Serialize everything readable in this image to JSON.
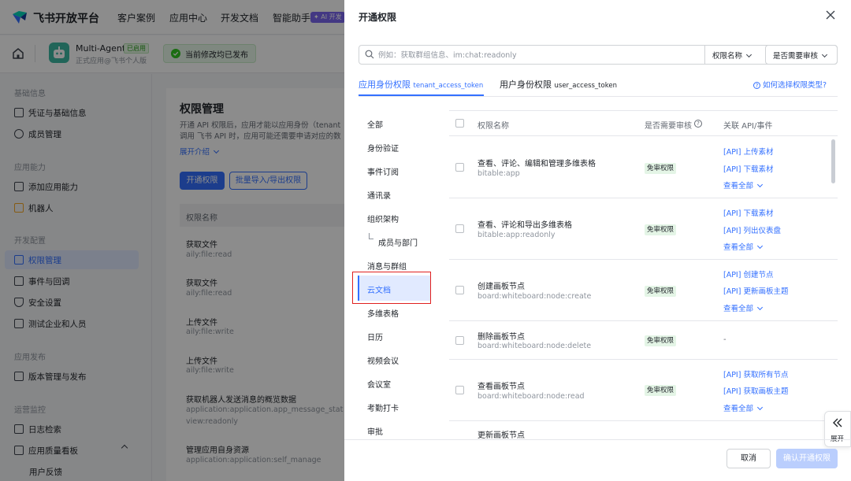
{
  "topnav": {
    "brand": "飞书开放平台",
    "items": [
      "客户案例",
      "应用中心",
      "开发文档",
      "智能助手"
    ],
    "ai_badge": "✦ AI 开发"
  },
  "app_header": {
    "app_name": "Multi-Agent",
    "app_badge": "已启用",
    "app_sub": "正式应用@飞书个人版",
    "publish_status": "当前修改均已发布"
  },
  "sidebar": {
    "groups": [
      {
        "title": "基础信息",
        "items": [
          "凭证与基础信息",
          "成员管理"
        ]
      },
      {
        "title": "应用能力",
        "items": [
          "添加应用能力",
          "机器人"
        ]
      },
      {
        "title": "开发配置",
        "items": [
          "权限管理",
          "事件与回调",
          "安全设置",
          "测试企业和人员"
        ]
      },
      {
        "title": "应用发布",
        "items": [
          "版本管理与发布"
        ]
      },
      {
        "title": "运营监控",
        "items": [
          "日志检索",
          "应用质量看板",
          "用户反馈"
        ]
      }
    ]
  },
  "main": {
    "title": "权限管理",
    "desc_line1": "开通 API 权限后，应用才能以应用身份（tenant",
    "desc_line2": "调用 飞书 API 时，应用可能还需要申请对应的数",
    "expand": "展开介绍",
    "btn_open": "开通权限",
    "btn_batch": "批量导入/导出权限",
    "col_name": "权限名称",
    "rows": [
      {
        "name": "获取文件",
        "code": "aily:file:read"
      },
      {
        "name": "获取文件",
        "code": "aily:file:read"
      },
      {
        "name": "上传文件",
        "code": "aily:file:write"
      },
      {
        "name": "上传文件",
        "code": "aily:file:write"
      },
      {
        "name": "获取机器人发送消息的概览数据",
        "code": "application:application.app_message_stats.",
        "code2": "view:readonly"
      },
      {
        "name": "管理应用自身资源",
        "code": "application:application:self_manage"
      }
    ]
  },
  "drawer": {
    "title": "开通权限",
    "search_placeholder": "例如：获取群组信息、im:chat:readonly",
    "select_name": "权限名称",
    "select_review": "是否需要审核",
    "tab1": "应用身份权限",
    "tab1_sub": "tenant_access_token",
    "tab2": "用户身份权限",
    "tab2_sub": "user_access_token",
    "help": "如何选择权限类型?",
    "categories": [
      "全部",
      "身份验证",
      "事件订阅",
      "通讯录",
      "组织架构",
      "成员与部门",
      "消息与群组",
      "云文档",
      "多维表格",
      "日历",
      "视频会议",
      "会议室",
      "考勤打卡",
      "审批"
    ],
    "table_headers": {
      "name": "权限名称",
      "review": "是否需要审核",
      "api": "关联 API/事件"
    },
    "view_all": "查看全部",
    "rows": [
      {
        "name": "查看、评论、编辑和管理多维表格",
        "code": "bitable:app",
        "badge": "免审权限",
        "apis": [
          "[API] 上传素材",
          "[API] 下载素材"
        ],
        "more": true
      },
      {
        "name": "查看、评论和导出多维表格",
        "code": "bitable:app:readonly",
        "badge": "免审权限",
        "apis": [
          "[API] 下载素材",
          "[API] 列出仪表盘"
        ],
        "more": true
      },
      {
        "name": "创建画板节点",
        "code": "board:whiteboard:node:create",
        "badge": "免审权限",
        "apis": [
          "[API] 创建节点",
          "[API] 更新画板主题"
        ],
        "more": true
      },
      {
        "name": "删除画板节点",
        "code": "board:whiteboard:node:delete",
        "badge": "免审权限",
        "apis": [],
        "dash": "-"
      },
      {
        "name": "查看画板节点",
        "code": "board:whiteboard:node:read",
        "badge": "免审权限",
        "apis": [
          "[API] 获取所有节点",
          "[API] 获取画板主题"
        ],
        "more": true
      },
      {
        "name": "更新画板节点"
      }
    ],
    "expand_label": "展开",
    "cancel": "取消",
    "confirm": "确认开通权限"
  }
}
